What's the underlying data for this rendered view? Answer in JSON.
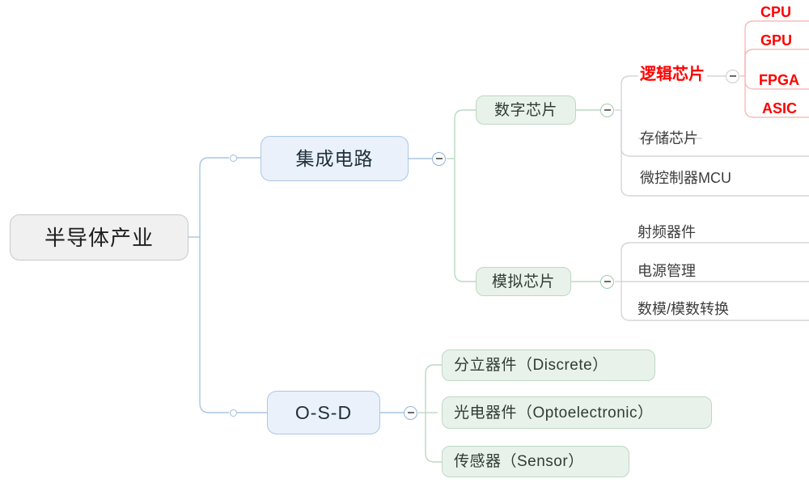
{
  "diagram": {
    "type": "mind-map",
    "title": "半导体产业",
    "colors": {
      "root_fill": "#f0f0f0",
      "root_border": "#c9c9c9",
      "blue_fill": "#eaf1fa",
      "blue_border": "#aac7e4",
      "green_fill": "#e9f2ea",
      "green_border": "#bcd9c2",
      "edge_blue": "#a9c6e2",
      "edge_green": "#bcd9c2",
      "edge_gray": "#d5d5d5",
      "edge_red": "#f6bdbd",
      "accent_red": "#ff0000",
      "text_dark": "#1d1d1d",
      "text_gray": "#3d3d3d"
    }
  },
  "root": {
    "label": "半导体产业"
  },
  "branches": {
    "integrated_circuit": {
      "label": "集成电路",
      "toggle": "collapse-minus",
      "children": {
        "digital_chip": {
          "label": "数字芯片",
          "toggle": "collapse-minus",
          "children": {
            "logic_chip": {
              "label": "逻辑芯片",
              "toggle": "collapse-minus",
              "children": [
                {
                  "label": "CPU"
                },
                {
                  "label": "GPU"
                },
                {
                  "label": "FPGA"
                },
                {
                  "label": "ASIC"
                }
              ]
            },
            "others": [
              {
                "label": "存储芯片"
              },
              {
                "label": "微控制器MCU"
              }
            ]
          }
        },
        "analog_chip": {
          "label": "模拟芯片",
          "toggle": "collapse-minus",
          "children": [
            {
              "label": "射频器件"
            },
            {
              "label": "电源管理"
            },
            {
              "label": "数模/模数转换"
            }
          ]
        }
      }
    },
    "osd": {
      "label": "O-S-D",
      "toggle": "collapse-minus",
      "children": [
        {
          "label": "分立器件（Discrete）"
        },
        {
          "label": "光电器件（Optoelectronic）"
        },
        {
          "label": "传感器（Sensor）"
        }
      ]
    }
  }
}
